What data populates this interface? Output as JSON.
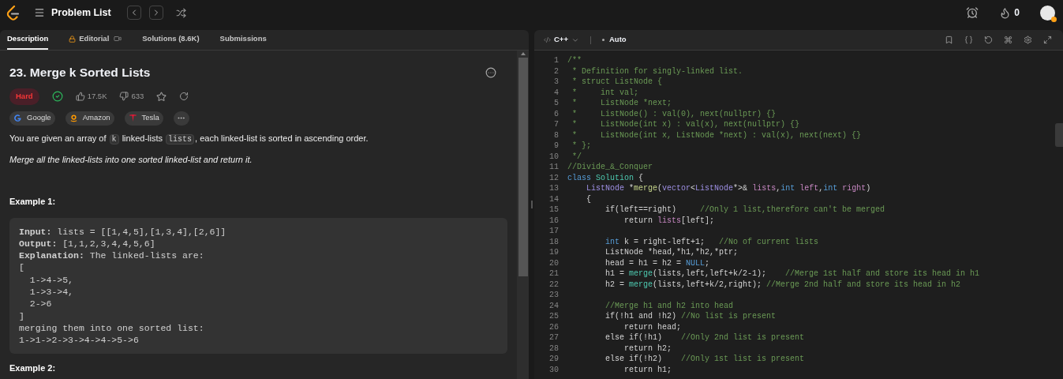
{
  "top_bar": {
    "title": "Problem List",
    "streak": "0"
  },
  "tabs": [
    {
      "label": "Description",
      "selected": true,
      "kind": "plain"
    },
    {
      "label": "Editorial",
      "selected": false,
      "kind": "locked"
    },
    {
      "label": "Solutions (8.6K)",
      "selected": false,
      "kind": "plain"
    },
    {
      "label": "Submissions",
      "selected": false,
      "kind": "plain"
    }
  ],
  "problem": {
    "title": "23. Merge k Sorted Lists",
    "difficulty": "Hard",
    "solved": true,
    "likes": "17.5K",
    "dislikes": "633",
    "companies": [
      {
        "name": "Google",
        "kind": "google"
      },
      {
        "name": "Amazon",
        "kind": "amazon"
      },
      {
        "name": "Tesla",
        "kind": "tesla"
      }
    ],
    "description": [
      {
        "kind": "text",
        "text": "You are given an array of "
      },
      {
        "kind": "code",
        "text": "k"
      },
      {
        "kind": "text",
        "text": " linked-lists "
      },
      {
        "kind": "code",
        "text": "lists"
      },
      {
        "kind": "text",
        "text": ", each linked-list is sorted in ascending order."
      }
    ],
    "instruction": "Merge all the linked-lists into one sorted linked-list and return it.",
    "examples": [
      {
        "heading": "Example 1:",
        "lines": [
          "**Input:** lists = [[1,4,5],[1,3,4],[2,6]]",
          "**Output:** [1,1,2,3,4,4,5,6]",
          "**Explanation:** The linked-lists are:",
          "[",
          "  1->4->5,",
          "  1->3->4,",
          "  2->6",
          "]",
          "merging them into one sorted list:",
          "1->1->2->3->4->4->5->6"
        ]
      },
      {
        "heading": "Example 2:"
      }
    ]
  },
  "editor": {
    "language": "C++",
    "mode": "Auto",
    "lines": [
      {
        "number": "1",
        "tokens": [
          {
            "kind": "comment",
            "text": "/**"
          }
        ]
      },
      {
        "number": "2",
        "tokens": [
          {
            "kind": "comment",
            "text": " * Definition for singly-linked list."
          }
        ]
      },
      {
        "number": "3",
        "tokens": [
          {
            "kind": "comment",
            "text": " * struct ListNode {"
          }
        ]
      },
      {
        "number": "4",
        "tokens": [
          {
            "kind": "comment",
            "text": " *     int val;"
          }
        ]
      },
      {
        "number": "5",
        "tokens": [
          {
            "kind": "comment",
            "text": " *     ListNode *next;"
          }
        ]
      },
      {
        "number": "6",
        "tokens": [
          {
            "kind": "comment",
            "text": " *     ListNode() : val(0), next(nullptr) {}"
          }
        ]
      },
      {
        "number": "7",
        "tokens": [
          {
            "kind": "comment",
            "text": " *     ListNode(int x) : val(x), next(nullptr) {}"
          }
        ]
      },
      {
        "number": "8",
        "tokens": [
          {
            "kind": "comment",
            "text": " *     ListNode(int x, ListNode *next) : val(x), next(next) {}"
          }
        ]
      },
      {
        "number": "9",
        "tokens": [
          {
            "kind": "comment",
            "text": " * };"
          }
        ]
      },
      {
        "number": "10",
        "tokens": [
          {
            "kind": "comment",
            "text": " */"
          }
        ]
      },
      {
        "number": "11",
        "tokens": [
          {
            "kind": "comment",
            "text": "//Divide_&_Conquer"
          }
        ]
      },
      {
        "number": "12",
        "tokens": [
          {
            "kind": "keyword",
            "text": "class"
          },
          {
            "kind": "func",
            "text": " Solution"
          },
          {
            "kind": "plain",
            "text": " {"
          }
        ]
      },
      {
        "number": "13",
        "tokens": [
          {
            "kind": "type",
            "text": "    ListNode"
          },
          {
            "kind": "plain",
            "text": " *"
          },
          {
            "kind": "method",
            "text": "merge"
          },
          {
            "kind": "plain",
            "text": "("
          },
          {
            "kind": "type",
            "text": "vector"
          },
          {
            "kind": "plain",
            "text": "<"
          },
          {
            "kind": "type",
            "text": "ListNode"
          },
          {
            "kind": "plain",
            "text": "*>& "
          },
          {
            "kind": "param",
            "text": "lists"
          },
          {
            "kind": "plain",
            "text": ","
          },
          {
            "kind": "keyword",
            "text": "int"
          },
          {
            "kind": "param",
            "text": " left"
          },
          {
            "kind": "plain",
            "text": ","
          },
          {
            "kind": "keyword",
            "text": "int"
          },
          {
            "kind": "param",
            "text": " right"
          },
          {
            "kind": "plain",
            "text": ")"
          }
        ]
      },
      {
        "number": "14",
        "tokens": [
          {
            "kind": "plain",
            "text": "    {"
          }
        ]
      },
      {
        "number": "15",
        "tokens": [
          {
            "kind": "plain",
            "text": "        if(left==right)"
          },
          {
            "kind": "comment",
            "text": "     //Only 1 list,therefore can't be merged"
          }
        ]
      },
      {
        "number": "16",
        "tokens": [
          {
            "kind": "plain",
            "text": "            return "
          },
          {
            "kind": "param",
            "text": "lists"
          },
          {
            "kind": "plain",
            "text": "[left];"
          }
        ]
      },
      {
        "number": "17"
      },
      {
        "number": "18",
        "tokens": [
          {
            "kind": "keyword",
            "text": "        int"
          },
          {
            "kind": "plain",
            "text": " k = right-left+1;"
          },
          {
            "kind": "comment",
            "text": "   //No of current lists"
          }
        ]
      },
      {
        "number": "19",
        "tokens": [
          {
            "kind": "plain",
            "text": "        ListNode *head,*h1,*h2,*ptr;"
          }
        ]
      },
      {
        "number": "20",
        "tokens": [
          {
            "kind": "plain",
            "text": "        head = h1 = h2 = "
          },
          {
            "kind": "keyword",
            "text": "NULL"
          },
          {
            "kind": "plain",
            "text": ";"
          }
        ]
      },
      {
        "number": "21",
        "tokens": [
          {
            "kind": "plain",
            "text": "        h1 = "
          },
          {
            "kind": "func",
            "text": "merge"
          },
          {
            "kind": "plain",
            "text": "(lists,left,left+k/2-1);"
          },
          {
            "kind": "comment",
            "text": "    //Merge 1st half and store its head in h1"
          }
        ]
      },
      {
        "number": "22",
        "tokens": [
          {
            "kind": "plain",
            "text": "        h2 = "
          },
          {
            "kind": "func",
            "text": "merge"
          },
          {
            "kind": "plain",
            "text": "(lists,left+k/2,right);"
          },
          {
            "kind": "comment",
            "text": " //Merge 2nd half and store its head in h2"
          }
        ]
      },
      {
        "number": "23"
      },
      {
        "number": "24",
        "tokens": [
          {
            "kind": "comment",
            "text": "        //Merge h1 and h2 into head"
          }
        ]
      },
      {
        "number": "25",
        "tokens": [
          {
            "kind": "plain",
            "text": "        if(!h1 and !h2)"
          },
          {
            "kind": "comment",
            "text": " //No list is present"
          }
        ]
      },
      {
        "number": "26",
        "tokens": [
          {
            "kind": "plain",
            "text": "            return head;"
          }
        ]
      },
      {
        "number": "27",
        "tokens": [
          {
            "kind": "plain",
            "text": "        else if(!h1)"
          },
          {
            "kind": "comment",
            "text": "    //Only 2nd list is present"
          }
        ]
      },
      {
        "number": "28",
        "tokens": [
          {
            "kind": "plain",
            "text": "            return h2;"
          }
        ]
      },
      {
        "number": "29",
        "tokens": [
          {
            "kind": "plain",
            "text": "        else if(!h2)"
          },
          {
            "kind": "comment",
            "text": "    //Only 1st list is present"
          }
        ]
      },
      {
        "number": "30",
        "tokens": [
          {
            "kind": "plain",
            "text": "            return h1;"
          }
        ]
      }
    ]
  }
}
